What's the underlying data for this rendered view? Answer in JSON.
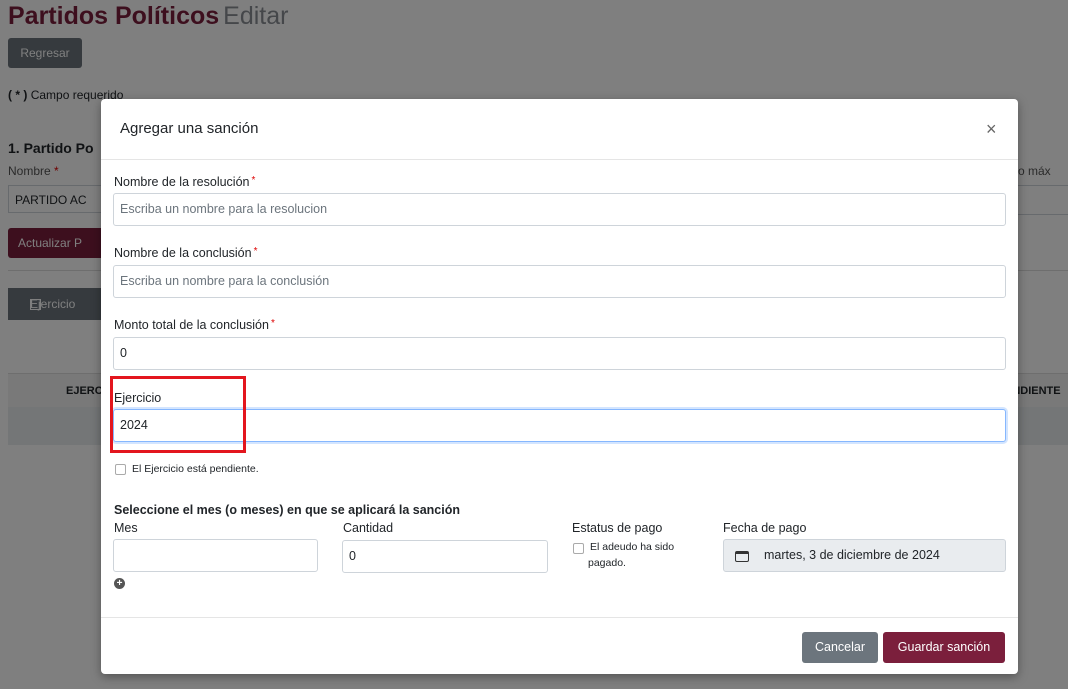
{
  "background": {
    "title": "Partidos Políticos",
    "title_suffix": "Editar",
    "back_button": "Regresar",
    "required_note_mark": "( * )",
    "required_note_text": "Campo requerido",
    "section_title": "1. Partido Po",
    "nombre_label": "Nombre",
    "nombre_value": "PARTIDO AC",
    "update_button": "Actualizar P",
    "ejercicio_button": "Ejercicio",
    "table_header_ejercicio": "EJERC",
    "table_header_pendiente": "ENDIENTE",
    "monto_label": "nto máx"
  },
  "modal": {
    "title": "Agregar una sanción",
    "close_icon": "×",
    "resolucion_label": "Nombre de la resolución",
    "resolucion_placeholder": "Escriba un nombre para la resolucion",
    "conclusion_label": "Nombre de la conclusión",
    "conclusion_placeholder": "Escriba un nombre para la conclusión",
    "monto_label": "Monto total de la conclusión",
    "monto_value": "0",
    "ejercicio_label": "Ejercicio",
    "ejercicio_value": "2024",
    "pendiente_checkbox_label": "El Ejercicio está pendiente.",
    "mes_section_title": "Seleccione el mes (o meses) en que se aplicará la sanción",
    "mes_label": "Mes",
    "mes_value": "",
    "cantidad_label": "Cantidad",
    "cantidad_value": "0",
    "estatus_label": "Estatus de pago",
    "estatus_checkbox_line1": "El adeudo ha sido",
    "estatus_checkbox_line2": "pagado.",
    "fecha_label": "Fecha de pago",
    "fecha_value": "martes, 3 de diciembre de 2024",
    "required_star": "*",
    "cancel_button": "Cancelar",
    "save_button": "Guardar sanción"
  },
  "colors": {
    "brand": "#7b1f3c",
    "secondary": "#6c757d",
    "highlight": "#e3161e"
  }
}
